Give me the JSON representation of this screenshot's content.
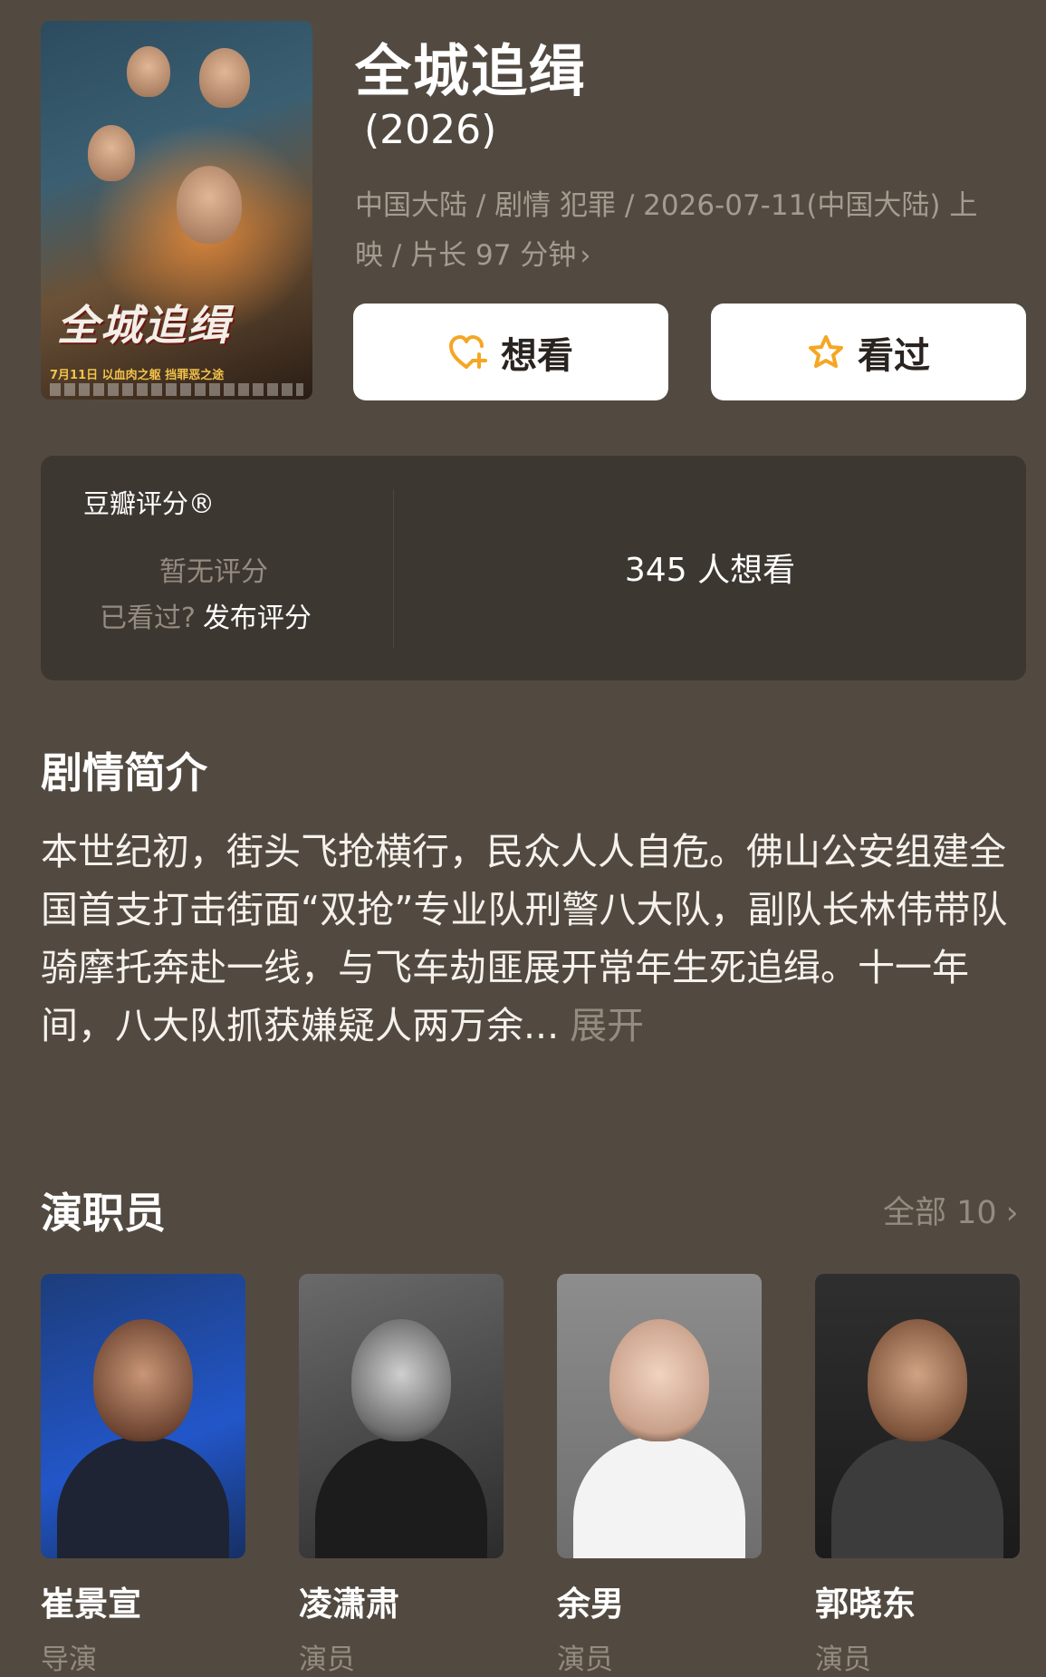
{
  "movie": {
    "title": "全城追缉",
    "year": "(2026)",
    "meta_line1": "中国大陆 / 剧情 犯罪 / 2026-07-11(中国大陆) 上",
    "meta_line2": "映 / 片长 97 分钟",
    "poster": {
      "title_art": "全城追缉",
      "tagline": "7月11日 以血肉之躯 挡罪恶之途"
    }
  },
  "actions": {
    "want_label": "想看",
    "seen_label": "看过"
  },
  "rating": {
    "label": "豆瓣评分®",
    "no_score": "暂无评分",
    "seen_prompt": "已看过?",
    "publish_label": "发布评分",
    "want_count": "345 人想看"
  },
  "synopsis": {
    "title": "剧情简介",
    "text": "本世纪初，街头飞抢横行，民众人人自危。佛山公安组建全国首支打击街面“双抢”专业队刑警八大队，副队长林伟带队骑摩托奔赴一线，与飞车劫匪展开常年生死追缉。十一年间，八大队抓获嫌疑人两万余...",
    "more_label": "展开"
  },
  "cast": {
    "title": "演职员",
    "all_label": "全部 10",
    "members": [
      {
        "name": "崔景宣",
        "role": "导演"
      },
      {
        "name": "凌潇肃",
        "role": "演员"
      },
      {
        "name": "余男",
        "role": "演员"
      },
      {
        "name": "郭晓东",
        "role": "演员"
      }
    ]
  },
  "colors": {
    "background": "#524a41",
    "card": "#3d3731",
    "muted_text": "#958b80",
    "accent_orange": "#f5a623"
  }
}
